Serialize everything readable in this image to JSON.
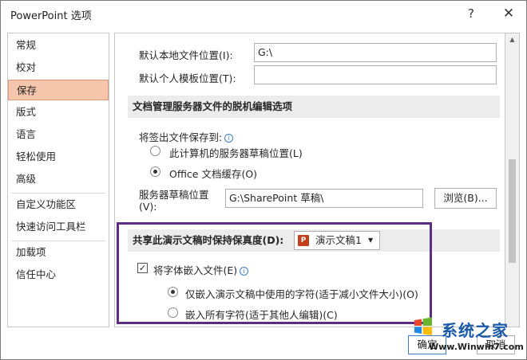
{
  "window": {
    "title": "PowerPoint 选项",
    "help": "?",
    "close": "✕"
  },
  "nav": {
    "items": [
      {
        "label": "常规"
      },
      {
        "label": "校对"
      },
      {
        "label": "保存"
      },
      {
        "label": "版式"
      },
      {
        "label": "语言"
      },
      {
        "label": "轻松使用"
      },
      {
        "label": "高级"
      },
      {
        "label": "自定义功能区"
      },
      {
        "label": "快速访问工具栏"
      },
      {
        "label": "加载项"
      },
      {
        "label": "信任中心"
      }
    ],
    "selected": "保存"
  },
  "save": {
    "local_location_label": "默认本地文件位置(I):",
    "local_location_value": "G:\\",
    "template_location_label": "默认个人模板位置(T):",
    "template_location_value": ""
  },
  "offline": {
    "header": "文档管理服务器文件的脱机编辑选项",
    "save_to_label": "将签出文件保存到:",
    "option_server_drafts": "此计算机的服务器草稿位置(L)",
    "option_office_cache": "Office 文档缓存(O)",
    "selected": "Office 文档缓存(O)",
    "drafts_location_label_1": "服务器草稿位置",
    "drafts_location_label_2": "(V):",
    "drafts_location_value": "G:\\SharePoint 草稿\\",
    "browse_label": "浏览(B)..."
  },
  "fidelity": {
    "header": "共享此演示文稿时保持保真度(D):",
    "presentation_name": "演示文稿1",
    "ppt_icon": "P",
    "embed_fonts_label": "将字体嵌入文件(E)",
    "embed_fonts_checked": true,
    "option_used_chars": "仅嵌入演示文稿中使用的字符(适于减小文件大小)(O)",
    "option_all_chars": "嵌入所有字符(适于其他人编辑)(C)",
    "selected": "仅嵌入演示文稿中使用的字符(适于减小文件大小)(O)"
  },
  "footer": {
    "ok": "确定",
    "cancel": "取消"
  },
  "watermark": {
    "text": "系统之家",
    "url": "Www.Winwin7.com"
  },
  "colors": {
    "accent_selected": "#f6c6ac",
    "highlight_border": "#5c2d82",
    "ppt_icon": "#c43e1c"
  }
}
